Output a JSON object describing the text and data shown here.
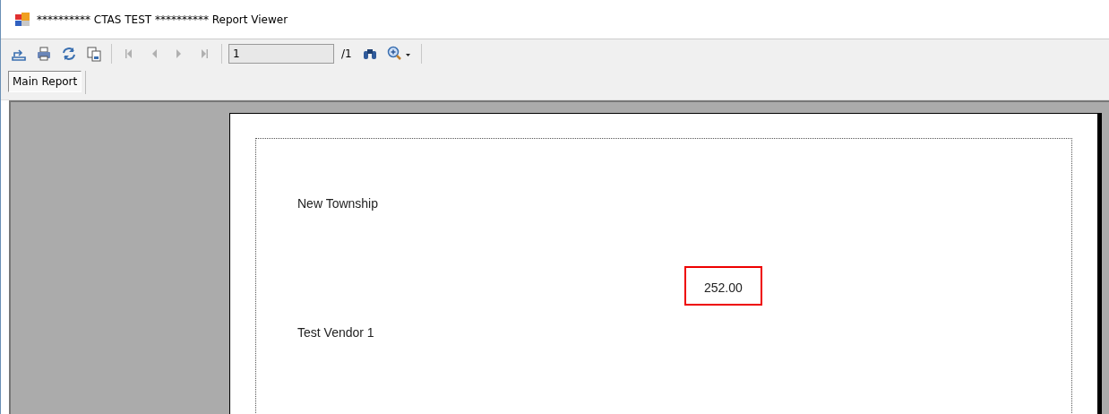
{
  "window": {
    "title": "********** CTAS TEST ********** Report Viewer"
  },
  "toolbar": {
    "buttons": [
      {
        "kind": "export",
        "disabled": false
      },
      {
        "kind": "print",
        "disabled": false
      },
      {
        "kind": "refresh",
        "disabled": false
      },
      {
        "kind": "copy",
        "disabled": false
      },
      {
        "kind": "separator"
      },
      {
        "kind": "first",
        "disabled": true
      },
      {
        "kind": "prev",
        "disabled": true
      },
      {
        "kind": "next",
        "disabled": true
      },
      {
        "kind": "last",
        "disabled": true
      },
      {
        "kind": "separator"
      }
    ],
    "page_field": {
      "value": "1"
    },
    "page_total": "/1",
    "tools": [
      {
        "kind": "find"
      },
      {
        "kind": "zoom"
      }
    ]
  },
  "tabs": [
    {
      "label": "Main Report",
      "selected": true
    }
  ],
  "report": {
    "fields": [
      {
        "text": "New Township",
        "highlighted": false
      },
      {
        "text": "252.00",
        "highlighted": true
      },
      {
        "text": "Test Vendor 1",
        "highlighted": false
      }
    ]
  }
}
